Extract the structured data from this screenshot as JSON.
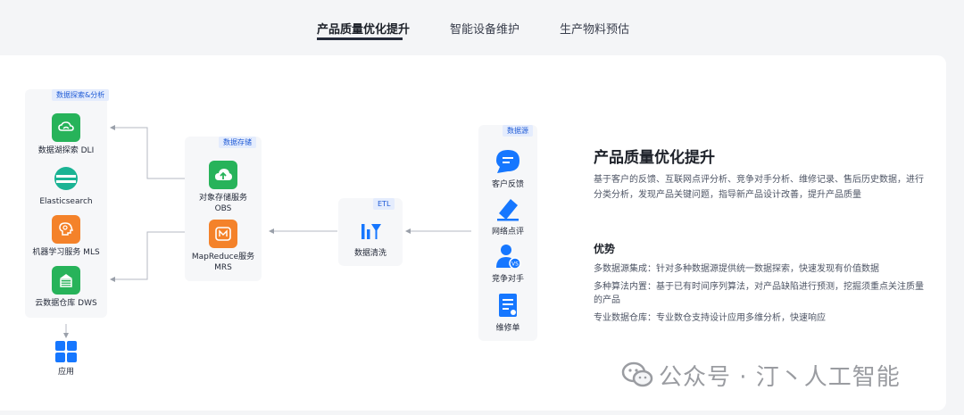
{
  "tabs": [
    {
      "label": "产品质量优化提升",
      "active": true
    },
    {
      "label": "智能设备维护",
      "active": false
    },
    {
      "label": "生产物料预估",
      "active": false
    }
  ],
  "diagram": {
    "groups": {
      "explore": "数据探索&分析",
      "storage": "数据存储",
      "etl": "ETL",
      "source": "数据源"
    },
    "explore_nodes": [
      {
        "label": "数据湖探索 DLI",
        "icon": "cloud-lake-icon"
      },
      {
        "label": "Elasticsearch",
        "icon": "elasticsearch-icon"
      },
      {
        "label": "机器学习服务 MLS",
        "icon": "brain-icon"
      },
      {
        "label": "云数据仓库 DWS",
        "icon": "database-icon"
      }
    ],
    "app_node": {
      "label": "应用",
      "icon": "apps-grid-icon"
    },
    "storage_nodes": [
      {
        "label_1": "对象存储服务",
        "label_2": "OBS",
        "icon": "cloud-upload-icon"
      },
      {
        "label_1": "MapReduce服务",
        "label_2": "MRS",
        "icon": "mapreduce-icon"
      }
    ],
    "etl_node": {
      "label": "数据清洗",
      "icon": "data-cleaning-icon"
    },
    "source_nodes": [
      {
        "label": "客户反馈",
        "icon": "chat-bubble-icon"
      },
      {
        "label": "网络点评",
        "icon": "pencil-icon"
      },
      {
        "label": "竞争对手",
        "icon": "versus-user-icon"
      },
      {
        "label": "维修单",
        "icon": "repair-form-icon"
      }
    ],
    "colors": {
      "green": "#27b35a",
      "orange": "#f4822a",
      "blue": "#1677ff",
      "tag_text": "#1f5bd6"
    }
  },
  "content": {
    "title": "产品质量优化提升",
    "description": "基于客户的反馈、互联网点评分析、竞争对手分析、维修记录、售后历史数据，进行分类分析，发现产品关键问题，指导新产品设计改善，提升产品质量",
    "advantages_title": "优势",
    "advantages": [
      "多数据源集成：针对多种数据源提供统一数据探索，快速发现有价值数据",
      "多种算法内置：基于已有时间序列算法，对产品缺陷进行预测，挖掘须重点关注质量的产品",
      "专业数据仓库：专业数仓支持设计应用多维分析，快速响应"
    ]
  },
  "watermark": {
    "text": "公众号 · 汀丶人工智能",
    "icon": "wechat-icon"
  }
}
